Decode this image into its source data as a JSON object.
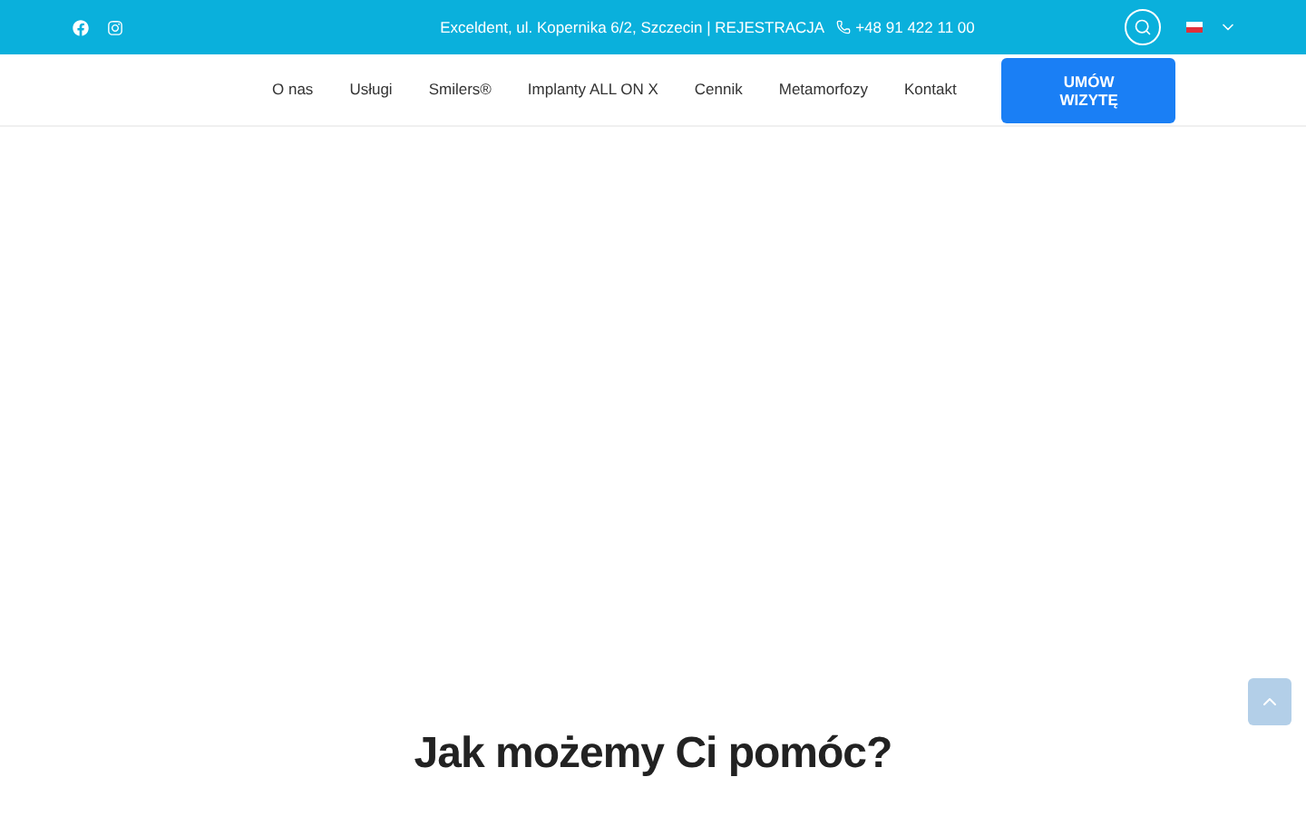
{
  "top_bar": {
    "address": "Exceldent, ul. Kopernika 6/2, Szczecin | REJESTRACJA",
    "phone": "+48 91 422 11 00"
  },
  "nav": {
    "items": [
      "O nas",
      "Usługi",
      "Smilers®",
      "Implanty ALL ON X",
      "Cennik",
      "Metamorfozy",
      "Kontakt"
    ],
    "cta": "UMÓW WIZYTĘ"
  },
  "heading": "Jak możemy Ci pomóc?"
}
